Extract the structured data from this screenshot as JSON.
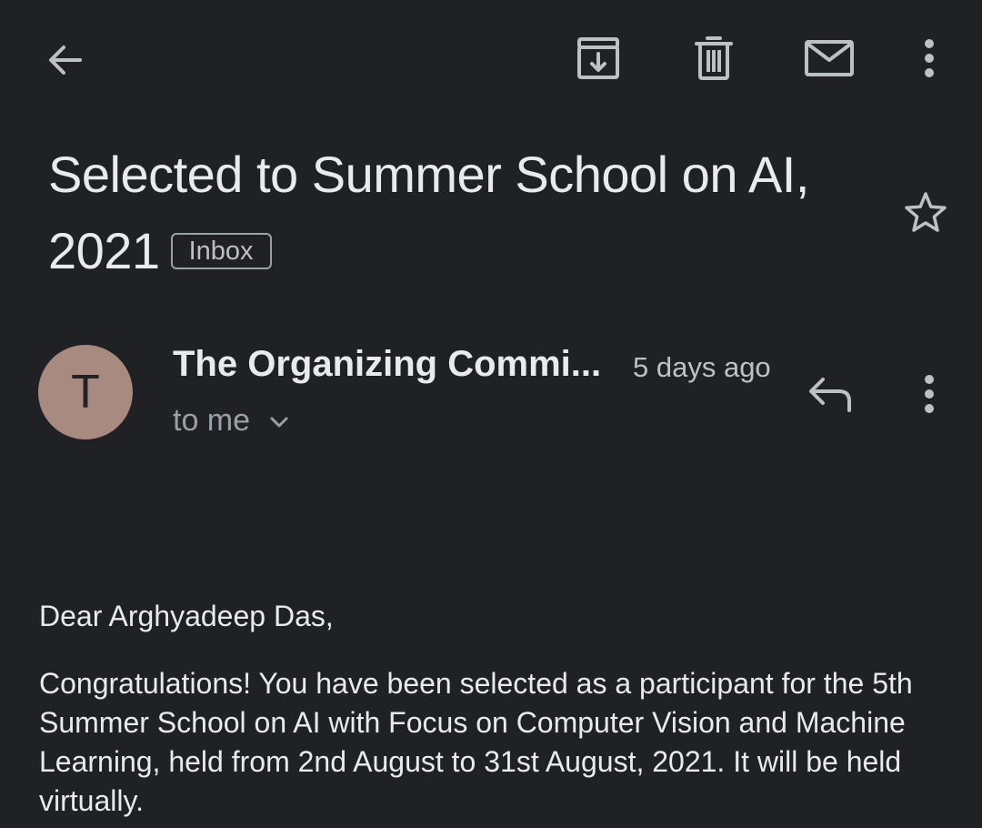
{
  "toolbar": {
    "back_icon": "arrow-left-icon",
    "archive_icon": "archive-icon",
    "delete_icon": "trash-icon",
    "mark_unread_icon": "mail-icon",
    "more_icon": "more-vert-icon"
  },
  "email": {
    "subject_line1": "Selected to Summer School on AI,",
    "subject_line2": "2021",
    "label": "Inbox",
    "starred": false
  },
  "sender": {
    "avatar_letter": "T",
    "avatar_color": "#a98a80",
    "name": "The Organizing Commi...",
    "time": "5 days ago",
    "recipients": "to me"
  },
  "body": {
    "greeting": "Dear Arghyadeep Das,",
    "paragraph1": "Congratulations! You have been selected as a participant for the 5th Summer School on AI with Focus on Computer Vision and Machine Learning, held from 2nd August to 31st August, 2021. It will be held virtually."
  },
  "colors": {
    "background": "#202124",
    "text": "#e8eaed",
    "secondary": "#9aa0a6"
  }
}
